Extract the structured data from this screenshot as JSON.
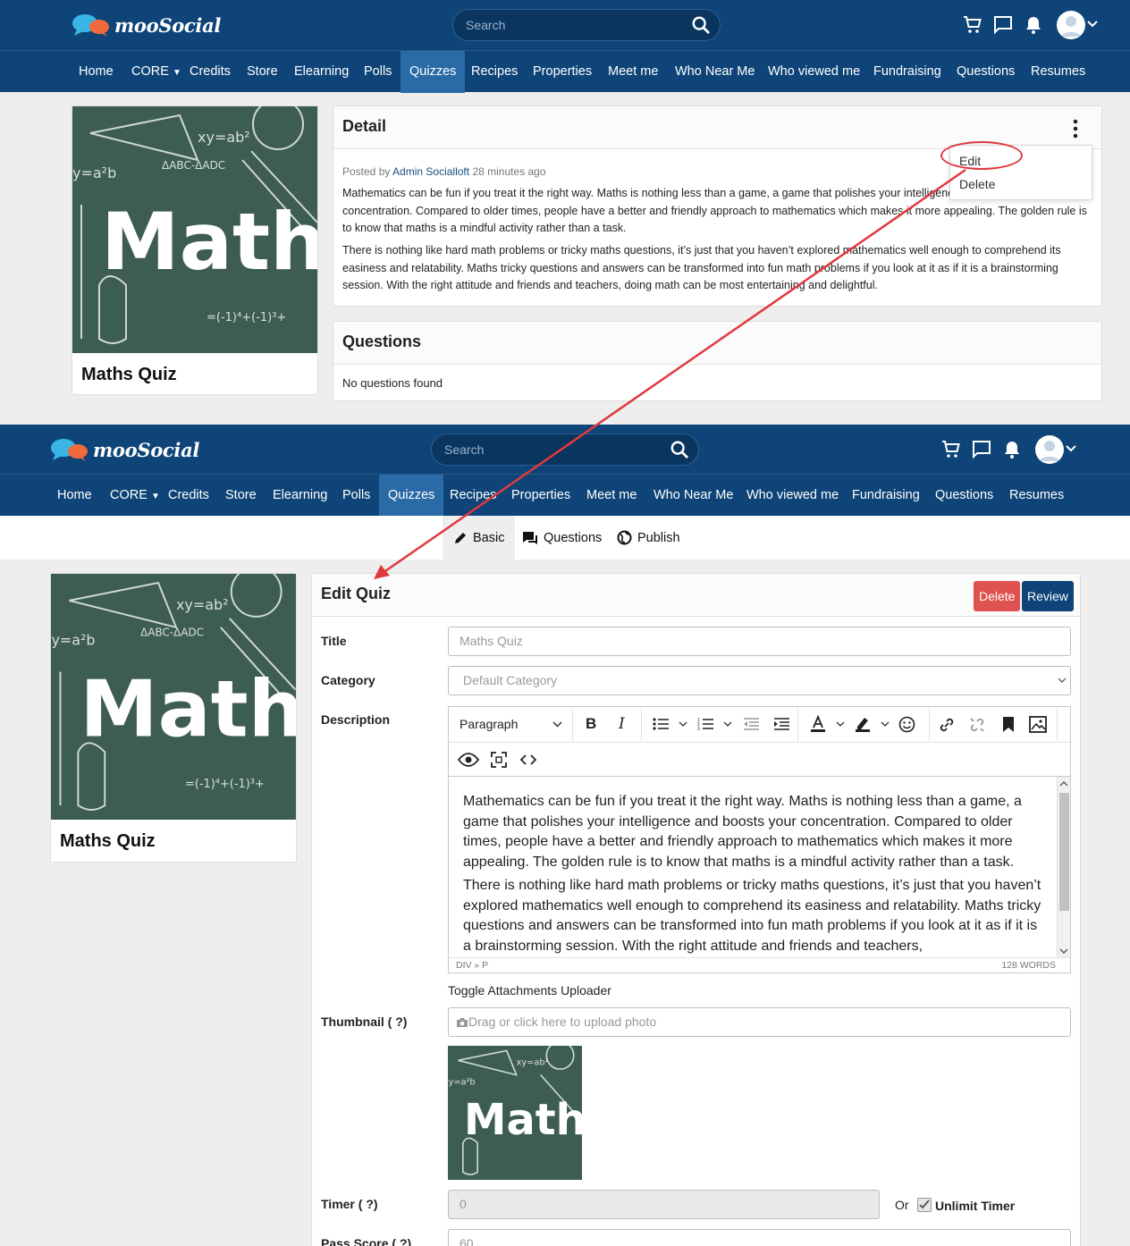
{
  "brand": {
    "name": "mooSocial"
  },
  "search": {
    "placeholder": "Search"
  },
  "nav": {
    "items": [
      "Home",
      "CORE",
      "Credits",
      "Store",
      "Elearning",
      "Polls",
      "Quizzes",
      "Recipes",
      "Properties",
      "Meet me",
      "Who Near Me",
      "Who viewed me",
      "Fundraising",
      "Questions",
      "Resumes"
    ],
    "active": "Quizzes"
  },
  "quiz": {
    "title": "Maths Quiz",
    "cover_text": "Math"
  },
  "detail": {
    "heading": "Detail",
    "posted_prefix": "Posted by",
    "author": "Admin Socialloft",
    "posted_time": "28 minutes ago",
    "paragraphs": [
      "Mathematics can be fun if you treat it the right way. Maths is nothing less than a game, a game that polishes your intelligence and boosts your concentration. Compared to older times, people have a better and friendly approach to mathematics which makes it more appealing. The golden rule is to know that maths is a mindful activity rather than a task.",
      "There is nothing like hard math problems or tricky maths questions, it’s just that you haven’t explored mathematics well enough to comprehend its easiness and relatability. Maths tricky questions and answers can be transformed into fun math problems if you look at it as if it is a brainstorming session. With the right attitude and friends and teachers, doing math can be most entertaining and delightful."
    ],
    "menu": [
      "Edit",
      "Delete"
    ]
  },
  "questions_card": {
    "heading": "Questions",
    "empty": "No questions found"
  },
  "tabs": [
    "Basic",
    "Questions",
    "Publish"
  ],
  "edit_form": {
    "heading": "Edit Quiz",
    "delete_label": "Delete",
    "review_label": "Review",
    "title_label": "Title",
    "title_value": "Maths Quiz",
    "category_label": "Category",
    "category_value": "Default Category",
    "description_label": "Description",
    "editor_block": "Paragraph",
    "editor_path": "DIV » P",
    "editor_words": "128 WORDS",
    "editor_paragraphs": [
      "Mathematics can be fun if you treat it the right way. Maths is nothing less than a game, a game that polishes your intelligence and boosts your concentration. Compared to older times, people have a better and friendly approach to mathematics which makes it more appealing. The golden rule is to know that maths is a mindful activity rather than a task.",
      "There is nothing like hard math problems or tricky maths questions, it’s just that you haven’t explored mathematics well enough to comprehend its easiness and relatability. Maths tricky questions and answers can be transformed into fun math problems if you look at it as if it is a brainstorming session. With the right attitude and friends and teachers,"
    ],
    "toggle_attachments": "Toggle Attachments Uploader",
    "thumbnail_label": "Thumbnail ( ?)",
    "upload_placeholder": "Drag or click here to upload photo",
    "timer_label": "Timer ( ?)",
    "timer_value": "0",
    "or_label": "Or",
    "unlimit_label": "Unlimit Timer",
    "pass_score_label": "Pass Score ( ?)",
    "pass_score_value": "60"
  },
  "colors": {
    "header": "#0e4477",
    "active_nav": "#2a6aa6",
    "delete": "#e0524f",
    "review": "#0e4477",
    "annotation": "#e0393e"
  }
}
